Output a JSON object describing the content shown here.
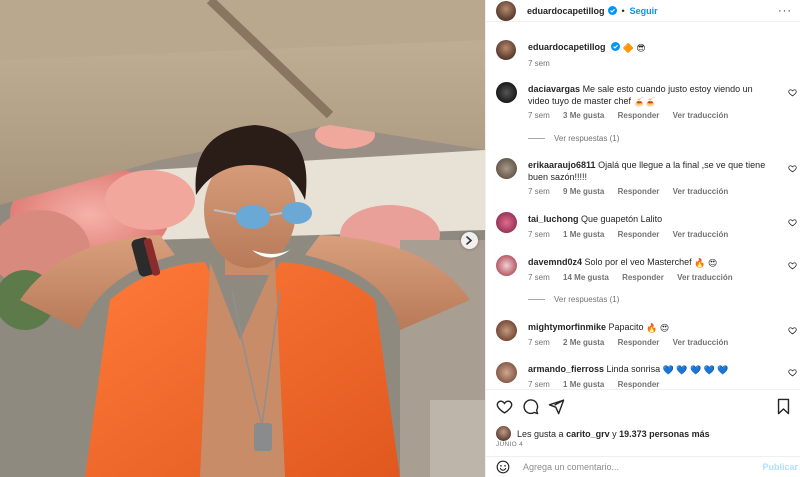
{
  "header": {
    "username": "eduardocapetillog",
    "separator": "•",
    "follow_label": "Seguir",
    "more_label": "···"
  },
  "caption": {
    "username": "eduardocapetillog",
    "emojis": "🔶 😎",
    "time": "7 sem"
  },
  "comments": [
    {
      "username": "daciavargas",
      "text": "Me sale esto cuando justo estoy viendo un video tuyo de master chef",
      "emojis": "🍝🍝",
      "time": "7 sem",
      "likes": "3 Me gusta",
      "reply_label": "Responder",
      "translate_label": "Ver traducción",
      "replies": "Ver respuestas (1)"
    },
    {
      "username": "erikaaraujo6811",
      "text": "Ojalá que llegue a la final ,se ve que tiene buen sazón!!!!!",
      "emojis": "",
      "time": "7 sem",
      "likes": "9 Me gusta",
      "reply_label": "Responder",
      "translate_label": "Ver traducción",
      "replies": ""
    },
    {
      "username": "tai_luchong",
      "text": "Que guapetón Lalito",
      "emojis": "",
      "time": "7 sem",
      "likes": "1 Me gusta",
      "reply_label": "Responder",
      "translate_label": "Ver traducción",
      "replies": ""
    },
    {
      "username": "davemnd0z4",
      "text": "Solo por el veo Masterchef",
      "emojis": "🔥 😍",
      "time": "7 sem",
      "likes": "14 Me gusta",
      "reply_label": "Responder",
      "translate_label": "Ver traducción",
      "replies": "Ver respuestas (1)"
    },
    {
      "username": "mightymorfinmike",
      "text": "Papacito",
      "emojis": "🔥 😍",
      "time": "7 sem",
      "likes": "2 Me gusta",
      "reply_label": "Responder",
      "translate_label": "Ver traducción",
      "replies": ""
    },
    {
      "username": "armando_fierross",
      "text": "Linda sonrisa",
      "emojis": "💙 💙 💙 💙 💙",
      "time": "7 sem",
      "likes": "1 Me gusta",
      "reply_label": "Responder",
      "translate_label": "",
      "replies": ""
    }
  ],
  "actions": {
    "icons": [
      "heart-icon",
      "comment-icon",
      "share-icon",
      "bookmark-icon"
    ]
  },
  "likes": {
    "prefix": "Les gusta a",
    "user": "carito_grv",
    "joiner": "y",
    "count": "19.373 personas más"
  },
  "date": "JUNIO 4",
  "add_comment": {
    "placeholder": "Agrega un comentario...",
    "publish_label": "Publicar"
  },
  "colors": {
    "accent": "#0095f6",
    "publish_disabled": "#b2dffc",
    "muted": "#737373",
    "shirt": "#f26a2b"
  }
}
